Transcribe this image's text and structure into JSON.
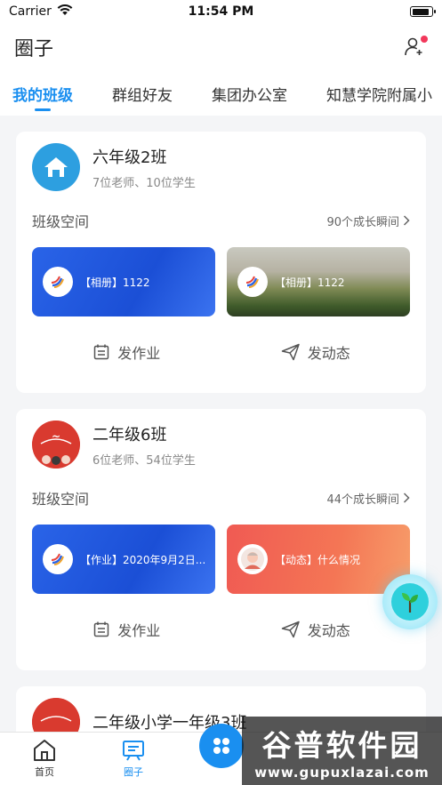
{
  "status": {
    "carrier": "Carrier",
    "time": "11:54 PM",
    "battery_level": 0.9
  },
  "header": {
    "title": "圈子",
    "contact_icon": "add-contact-icon"
  },
  "tabs": [
    {
      "label": "我的班级",
      "active": true
    },
    {
      "label": "群组好友",
      "active": false
    },
    {
      "label": "集团办公室",
      "active": false
    },
    {
      "label": "知慧学院附属小",
      "active": false
    }
  ],
  "classes": [
    {
      "name": "六年级2班",
      "sub": "7位老师、10位学生",
      "avatar": "home-icon",
      "space_label": "班级空间",
      "space_count": "90个成长瞬间",
      "tiles": [
        {
          "text": "【相册】1122",
          "style": "blue"
        },
        {
          "text": "【相册】1122",
          "style": "photo"
        }
      ],
      "actions": [
        {
          "label": "发作业",
          "icon": "calendar-icon"
        },
        {
          "label": "发动态",
          "icon": "send-icon"
        }
      ]
    },
    {
      "name": "二年级6班",
      "sub": "6位老师、54位学生",
      "avatar": "class-photo-avatar",
      "space_label": "班级空间",
      "space_count": "44个成长瞬间",
      "tiles": [
        {
          "text": "【作业】2020年9月2日...",
          "style": "blue"
        },
        {
          "text": "【动态】什么情况",
          "style": "red"
        }
      ],
      "actions": [
        {
          "label": "发作业",
          "icon": "calendar-icon"
        },
        {
          "label": "发动态",
          "icon": "send-icon"
        }
      ]
    },
    {
      "name": "二年级小学一年级3班",
      "avatar": "class-photo-avatar"
    }
  ],
  "bottom_nav": [
    {
      "label": "首页",
      "icon": "home-outline-icon",
      "active": false
    },
    {
      "label": "圈子",
      "icon": "board-icon",
      "active": true
    }
  ],
  "watermark": {
    "title": "谷普软件园",
    "url": "www.gupuxlazai.com"
  },
  "colors": {
    "accent": "#1a8ff0",
    "avatar_blue": "#2d9fe0",
    "red_dot": "#f2385b",
    "float_teal": "#2ed0dc"
  }
}
